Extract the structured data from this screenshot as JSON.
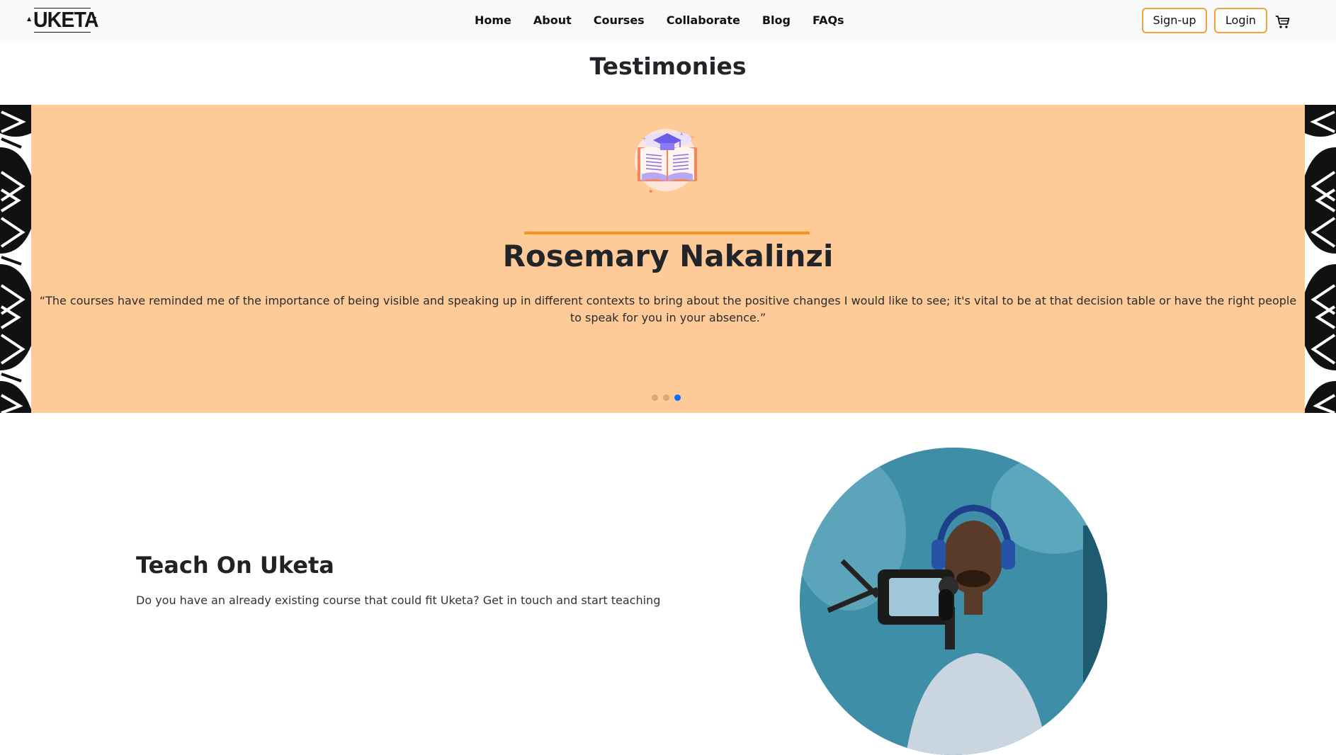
{
  "navbar": {
    "logo": "UKETA",
    "links": [
      "Home",
      "About",
      "Courses",
      "Collaborate",
      "Blog",
      "FAQs"
    ],
    "signup_label": "Sign-up",
    "login_label": "Login",
    "cart_icon": "cart-icon",
    "background": "#f8f9fa",
    "button_border": "#f2a13b"
  },
  "testimonies": {
    "title": "Testimonies",
    "background": "#fecb98",
    "accent": "#f3941d",
    "illustration": "graduation-book-icon",
    "name": "Rosemary Nakalinzi",
    "quote": "“The courses have reminded me of the importance of being visible and speaking up in different contexts to bring about the positive changes I would like to see; it's vital to be at that decision table or have the right people to speak for you in your absence.”",
    "slides_count": 3,
    "active_slide": 3,
    "active_dot_color": "#0d6efd"
  },
  "teach": {
    "title": "Teach On Uketa",
    "text": "Do you have an already existing course that could fit Uketa? Get in touch and start teaching",
    "photo": "instructor-with-headphones-photo"
  }
}
